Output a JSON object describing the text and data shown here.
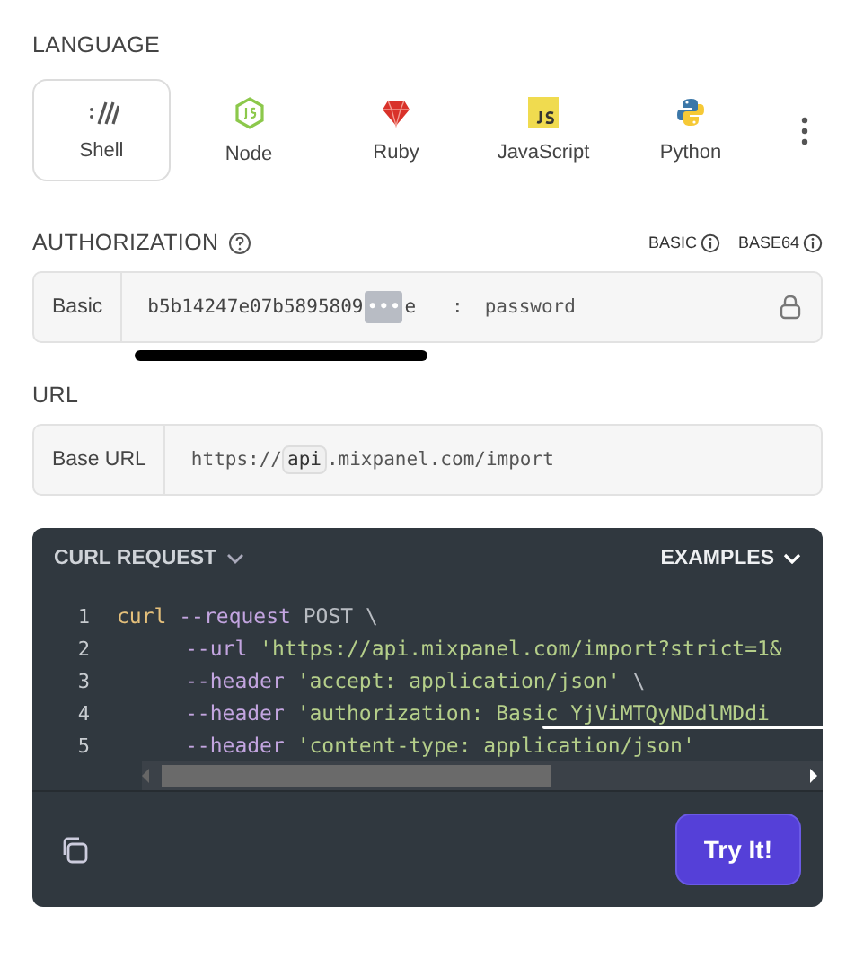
{
  "language": {
    "heading": "LANGUAGE",
    "options": [
      {
        "label": "Shell",
        "kind": "shell",
        "selected": true
      },
      {
        "label": "Node",
        "kind": "node",
        "selected": false
      },
      {
        "label": "Ruby",
        "kind": "ruby",
        "selected": false
      },
      {
        "label": "JavaScript",
        "kind": "javascript",
        "selected": false
      },
      {
        "label": "Python",
        "kind": "python",
        "selected": false
      }
    ]
  },
  "authorization": {
    "heading": "AUTHORIZATION",
    "links": [
      "BASIC",
      "BASE64"
    ],
    "scheme": "Basic",
    "username": "b5b14247e07b5895809",
    "masked": "•••",
    "username_end": "e",
    "separator": ":",
    "password": "password"
  },
  "url": {
    "heading": "URL",
    "label": "Base URL",
    "prefix": "https://",
    "host_part": "api",
    "suffix": ".mixpanel.com/import"
  },
  "code_panel": {
    "title": "CURL REQUEST",
    "examples": "EXAMPLES",
    "lines": [
      {
        "number": "1",
        "indent": false,
        "tokens": [
          {
            "kind": "command",
            "text": "curl"
          },
          {
            "kind": "flag",
            "text": " --request"
          },
          {
            "kind": "plain",
            "text": " POST \\"
          }
        ]
      },
      {
        "number": "2",
        "indent": true,
        "tokens": [
          {
            "kind": "flag",
            "text": "--url"
          },
          {
            "kind": "string",
            "text": " 'https://api.mixpanel.com/import?strict=1&"
          }
        ]
      },
      {
        "number": "3",
        "indent": true,
        "tokens": [
          {
            "kind": "flag",
            "text": "--header"
          },
          {
            "kind": "string",
            "text": " 'accept: application/json'"
          },
          {
            "kind": "plain",
            "text": " \\"
          }
        ]
      },
      {
        "number": "4",
        "indent": true,
        "tokens": [
          {
            "kind": "flag",
            "text": "--header"
          },
          {
            "kind": "string",
            "text": " 'authorization: Basic YjViMTQyNDdlMDdi"
          }
        ]
      },
      {
        "number": "5",
        "indent": true,
        "tokens": [
          {
            "kind": "flag",
            "text": "--header"
          },
          {
            "kind": "string",
            "text": " 'content-type: application/json'"
          }
        ]
      }
    ],
    "button": "Try It!"
  }
}
